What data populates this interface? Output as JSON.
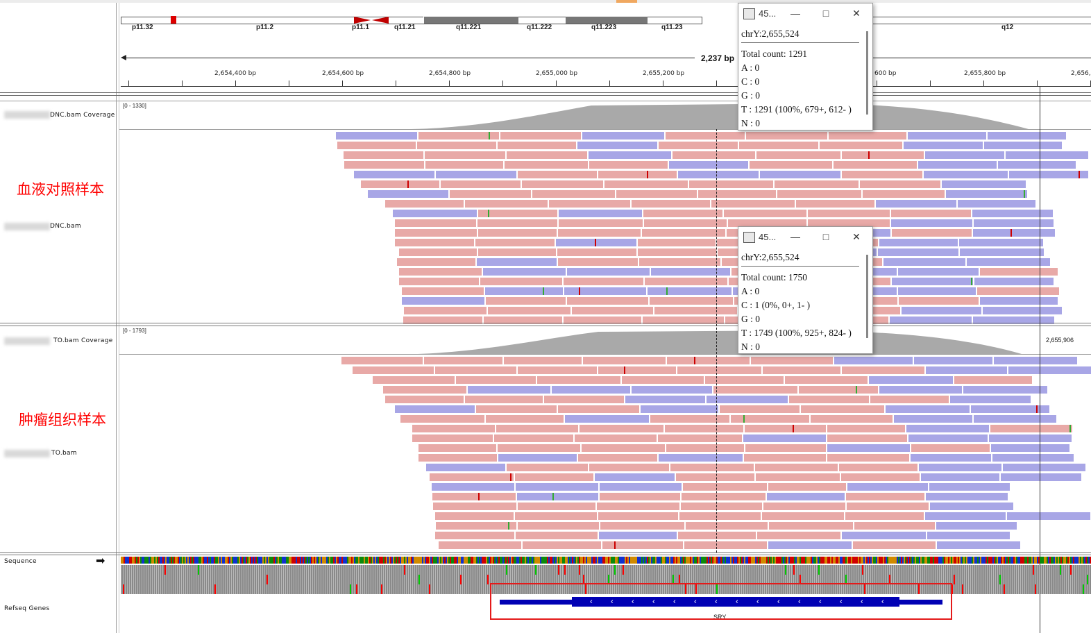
{
  "ideogram": {
    "bands": [
      "p11.32",
      "p11.2",
      "p11.1",
      "q11.21",
      "q11.221",
      "q11.222",
      "q11.223",
      "q11.23",
      "q12"
    ]
  },
  "ruler": {
    "span_label": "2,237 bp",
    "ticks": [
      "2,654,400 bp",
      "2,654,600 bp",
      "2,654,800 bp",
      "2,655,000 bp",
      "2,655,200 bp",
      "600 bp",
      "2,655,800 bp",
      "2,656,"
    ]
  },
  "tracks": {
    "control_coverage": {
      "name": "DNC.bam Coverage",
      "range": "[0 - 1330]"
    },
    "control_bam": {
      "name": "DNC.bam",
      "annotation": "血液对照样本"
    },
    "tumor_coverage": {
      "name": "TO.bam Coverage",
      "range": "[0 - 1793]",
      "marker_pos": "2,655,906"
    },
    "tumor_bam": {
      "name": "TO.bam",
      "annotation": "肿瘤组织样本"
    },
    "sequence": {
      "name": "Sequence",
      "arrow": "➡"
    },
    "refseq": {
      "name": "Refseq Genes",
      "gene": "SRY"
    }
  },
  "popups": [
    {
      "title": "45...",
      "locus": "chrY:2,655,524",
      "total": "Total count: 1291",
      "bases": [
        "A : 0",
        "C : 0",
        "G : 0",
        "T : 1291 (100%, 679+, 612- )",
        "N : 0"
      ]
    },
    {
      "title": "45...",
      "locus": "chrY:2,655,524",
      "total": "Total count: 1750",
      "bases": [
        "A : 0",
        "C : 1 (0%, 0+, 1- )",
        "G : 0",
        "T : 1749 (100%, 925+, 824- )",
        "N : 0"
      ]
    }
  ],
  "colors": {
    "forward_read": "#e8a9a7",
    "reverse_read": "#a8a6e6",
    "coverage": "#a9a9a9",
    "gene": "#0000b4",
    "highlight_box": "#e41a1a"
  }
}
